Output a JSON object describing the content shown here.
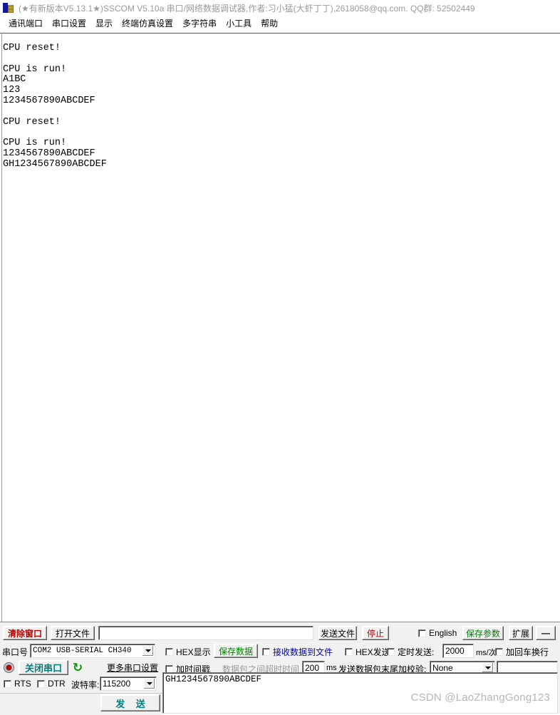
{
  "window": {
    "title": "(★有新版本V5.13.1★)SSCOM V5.10a 串口/网络数据调试器,作者:习小猛(大虾丁丁),2618058@qq.com. QQ群: 52502449",
    "icon": "sscom-app-icon"
  },
  "menubar": {
    "items": [
      {
        "label": "通讯端口"
      },
      {
        "label": "串口设置"
      },
      {
        "label": "显示"
      },
      {
        "label": "终端仿真设置"
      },
      {
        "label": "多字符串"
      },
      {
        "label": "小工具"
      },
      {
        "label": "帮助"
      }
    ]
  },
  "terminal": {
    "content": "CPU reset!\n\nCPU is run!\nA1BC\n123\n1234567890ABCDEF\n\nCPU reset!\n\nCPU is run!\n1234567890ABCDEF\nGH1234567890ABCDEF"
  },
  "toolbar": {
    "clear_window": "清除窗口",
    "open_file": "打开文件",
    "file_path_value": "",
    "file_path_placeholder": "",
    "send_file": "发送文件",
    "stop": "停止",
    "english_label": "English",
    "english_checked": false,
    "save_params": "保存参数",
    "extend": "扩展",
    "minimize": "—"
  },
  "serial": {
    "port_label": "串口号",
    "port_value": "COM2 USB-SERIAL CH340",
    "hex_display_label": "HEX显示",
    "hex_display_checked": false,
    "save_data": "保存数据",
    "recv_to_file_label": "接收数据到文件",
    "recv_to_file_checked": false,
    "hex_send_label": "HEX发送",
    "hex_send_checked": false,
    "timed_send_label": "定时发送:",
    "timed_send_checked": false,
    "timed_send_value": "2000",
    "ms_per_time_unit": "ms/次",
    "append_crlf_label": "加回车换行",
    "append_crlf_checked": false,
    "close_port": "关闭串口",
    "refresh_icon": "refresh-icon",
    "status_led": "led-red",
    "more_settings": "更多串口设置",
    "timestamp_label": "加时间戳",
    "timestamp_checked": false,
    "packet_timeout_label": "数据包之间超时时间",
    "packet_timeout_value": "200",
    "ms_unit": "ms",
    "checksum_label": "发送数据包末尾加校验:",
    "checksum_value": "None",
    "checksum_extra_value": "",
    "rts_label": "RTS",
    "rts_checked": false,
    "dtr_label": "DTR",
    "dtr_checked": false,
    "baud_label": "波特率:",
    "baud_value": "115200"
  },
  "send_area": {
    "text": "GH1234567890ABCDEF",
    "send_button": "发 送"
  },
  "watermark": {
    "text": "CSDN @LaoZhangGong123"
  },
  "colors": {
    "clear_window_red": "#b50000",
    "stop_red": "#b50000",
    "save_green": "#008000",
    "recv_blue": "#0000c0",
    "teal": "#007f7f",
    "refresh_green": "#00a000",
    "watermark_gray": "#b6b6b6",
    "title_gray": "#9a9a9a",
    "panel_bg": "#f1f1f1"
  }
}
